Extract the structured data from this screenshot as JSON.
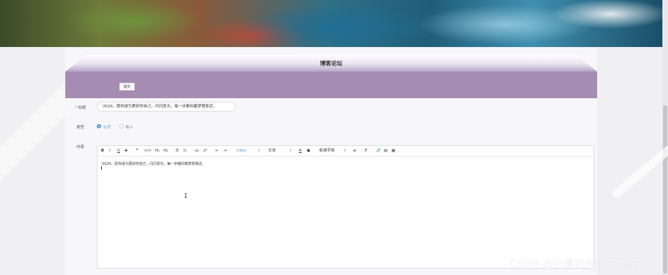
{
  "header": {
    "title": "博客论坛"
  },
  "toolbar_top": {
    "submit_label": "提交"
  },
  "form": {
    "title_label": "标题",
    "title_required_mark": "*",
    "title_value": "'2024，愿你成为更好的自己，闪闪发光，每一步都向着梦想靠近。",
    "type_label": "类型",
    "type_options": [
      "公开",
      "私人"
    ],
    "type_selected": "公开",
    "content_label": "内容"
  },
  "editor": {
    "toolbar": {
      "bold": "B",
      "italic": "I",
      "underline": "U",
      "strike": "S",
      "quote": "❞",
      "code": "</>",
      "h1": "H₁",
      "h2": "H₂",
      "ordered_list": "☰",
      "bullet_list": "☷",
      "subscript": "x₂",
      "superscript": "x²",
      "outdent": "⇤",
      "indent": "⇥",
      "font_size": "14px",
      "paragraph": "文本",
      "font_family": "标准字体",
      "align": "≡",
      "clear_format": "T̸"
    },
    "content": "'2024，愿你成为更好的自己，闪闪发光，每一步都向着梦想靠近。"
  },
  "watermark": "CSDN @计算机毕设工作室",
  "colors": {
    "band": "#a58cb2",
    "accent": "#4a90d9"
  }
}
